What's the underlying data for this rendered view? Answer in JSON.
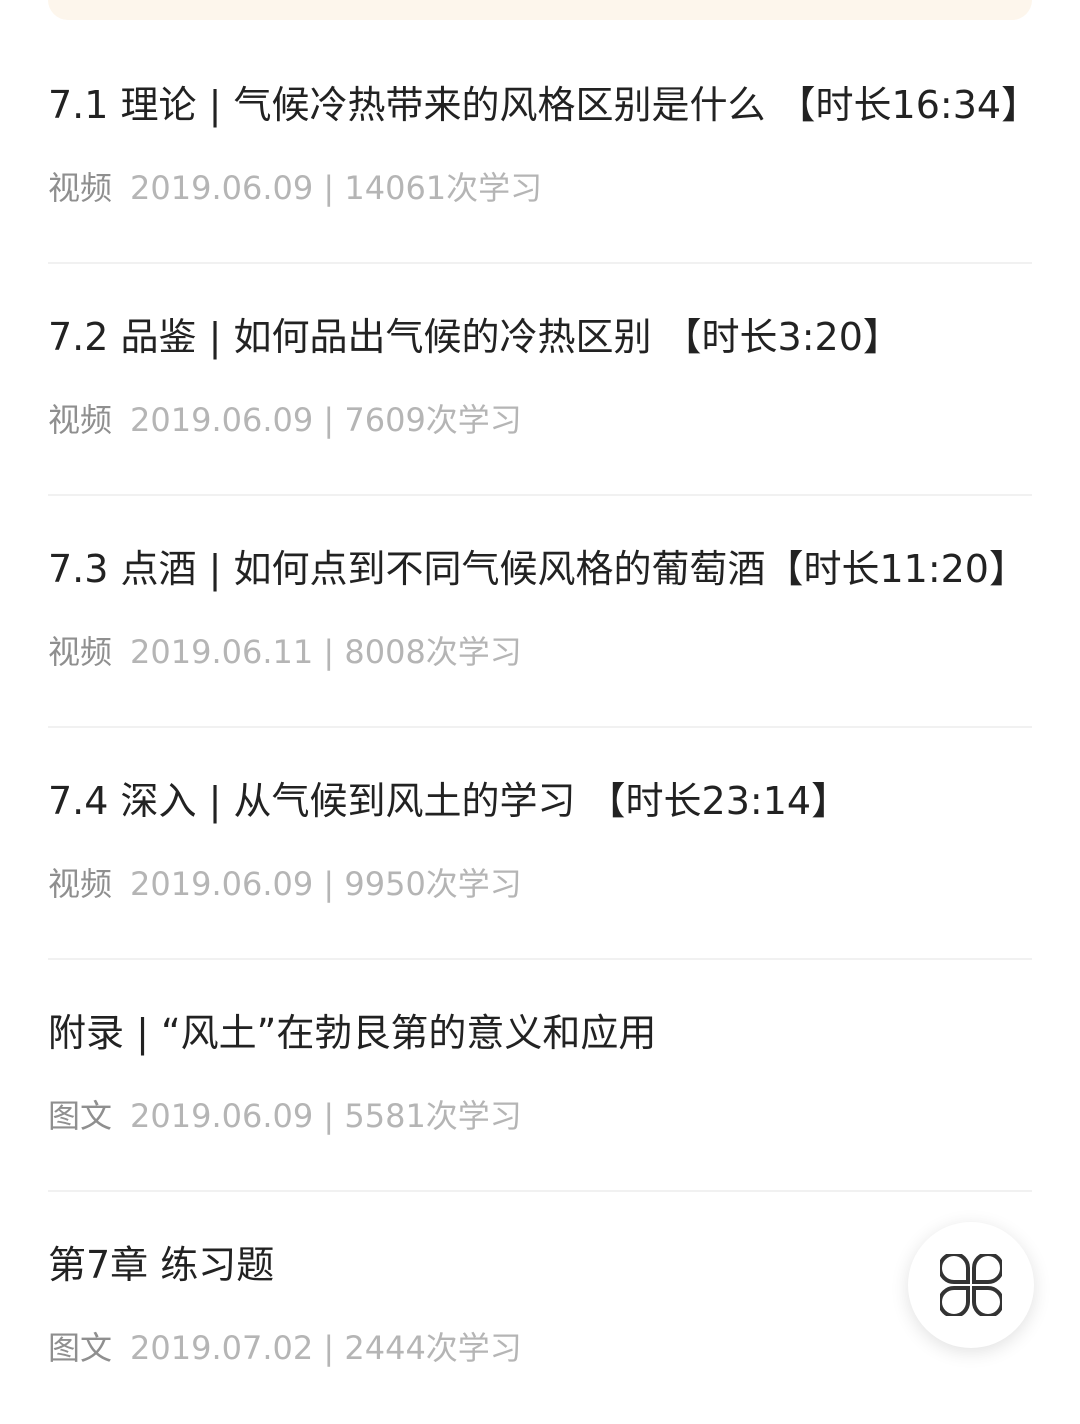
{
  "lessons": [
    {
      "title": "7.1 理论 | 气候冷热带来的风格区别是什么 【时长16:34】",
      "type": "视频",
      "info": "2019.06.09 | 14061次学习"
    },
    {
      "title": "7.2 品鉴 | 如何品出气候的冷热区别 【时长3:20】",
      "type": "视频",
      "info": "2019.06.09 | 7609次学习"
    },
    {
      "title": "7.3 点酒 | 如何点到不同气候风格的葡萄酒【时长11:20】",
      "type": "视频",
      "info": "2019.06.11 | 8008次学习"
    },
    {
      "title": "7.4 深入 | 从气候到风土的学习 【时长23:14】",
      "type": "视频",
      "info": "2019.06.09 | 9950次学习"
    },
    {
      "title": "附录 | “风土”在勃艮第的意义和应用",
      "type": "图文",
      "info": "2019.06.09 | 5581次学习"
    },
    {
      "title": "第7章 练习题",
      "type": "图文",
      "info": "2019.07.02 | 2444次学习"
    }
  ],
  "fab": {
    "icon": "clover-menu-icon"
  }
}
